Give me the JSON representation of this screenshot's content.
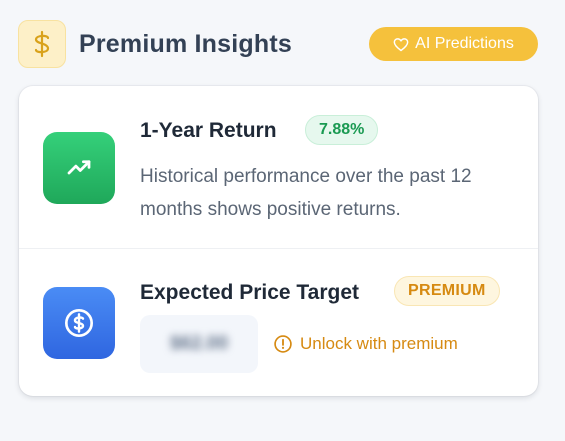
{
  "header": {
    "title": "Premium Insights",
    "logo_icon": "dollar-icon",
    "ai_button": {
      "label": "AI Predictions",
      "icon": "heart-icon"
    }
  },
  "return_row": {
    "icon": "trending-up-icon",
    "title": "1-Year Return",
    "badge": "7.88%",
    "description": "Historical performance over the past 12 months shows positive returns."
  },
  "price_row": {
    "icon": "dollar-circle-icon",
    "title": "Expected Price Target",
    "badge": "PREMIUM",
    "blurred_value": "$62.00",
    "unlock_label": "Unlock with premium",
    "unlock_icon": "alert-circle-icon"
  },
  "colors": {
    "accent": "#f5c13c",
    "green": "#1fa85a",
    "blue": "#2f66e0",
    "premium": "#d68a12"
  }
}
